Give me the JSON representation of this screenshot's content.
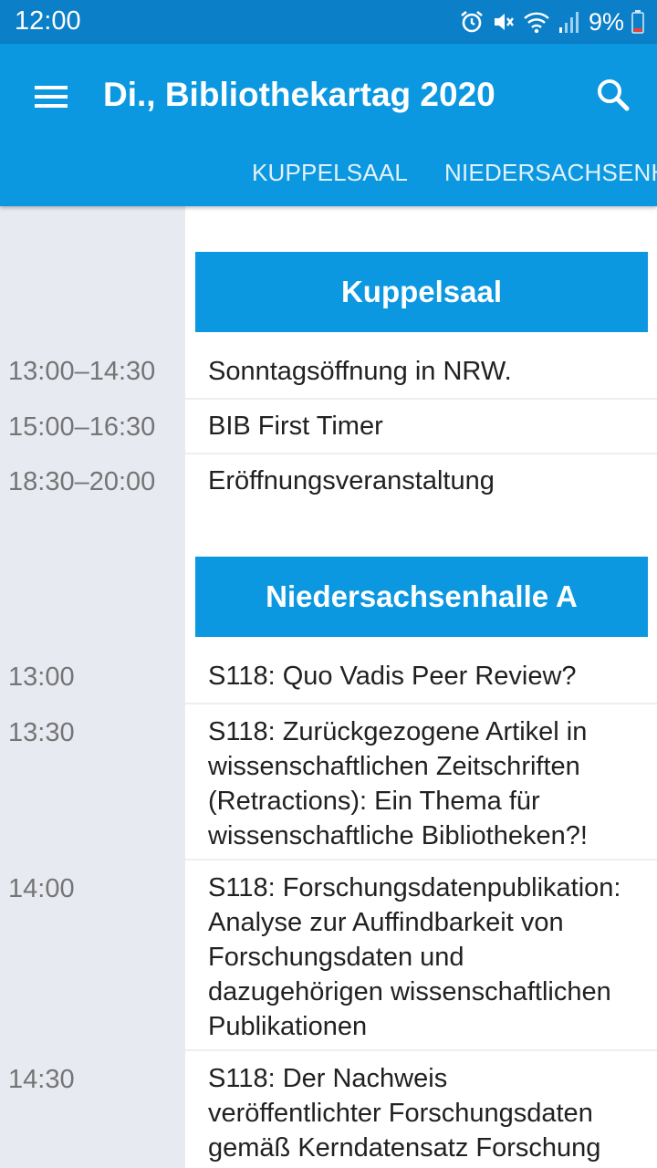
{
  "status_bar": {
    "time": "12:00",
    "battery_percent": "9%",
    "icons": [
      "alarm-icon",
      "mute-icon",
      "wifi-icon",
      "signal-icon",
      "battery-icon"
    ]
  },
  "app_bar": {
    "title": "Di., Bibliothekartag 2020",
    "menu_icon": "hamburger-menu-icon",
    "search_icon": "search-icon"
  },
  "tabs": [
    "KUPPELSAAL",
    "NIEDERSACHSENHALLE A"
  ],
  "colors": {
    "status_bar": "#0b7fc7",
    "primary": "#0c98e0",
    "time_column": "#e8eaf1"
  },
  "schedule": [
    {
      "room": "Kuppelsaal",
      "sessions": [
        {
          "time": "13:00–14:30",
          "title": "Sonntagsöffnung in NRW."
        },
        {
          "time": "15:00–16:30",
          "title": "BIB First Timer"
        },
        {
          "time": "18:30–20:00",
          "title": "Eröffnungsveranstaltung"
        }
      ]
    },
    {
      "room": "Niedersachsenhalle A",
      "sessions": [
        {
          "time": "13:00",
          "title": "S118: Quo Vadis Peer Review?"
        },
        {
          "time": "13:30",
          "title": "S118: Zurückgezogene Artikel in wissenschaftlichen Zeitschriften (Retractions): Ein Thema für wissenschaftliche Bibliotheken?!"
        },
        {
          "time": "14:00",
          "title": "S118: Forschungsdatenpublikation: Analyse zur Auffindbarkeit von Forschungsdaten und dazugehörigen wissenschaftlichen Publikationen"
        },
        {
          "time": "14:30",
          "title": "S118: Der Nachweis veröffentlichter Forschungsdaten gemäß Kerndatensatz Forschung"
        }
      ]
    }
  ]
}
